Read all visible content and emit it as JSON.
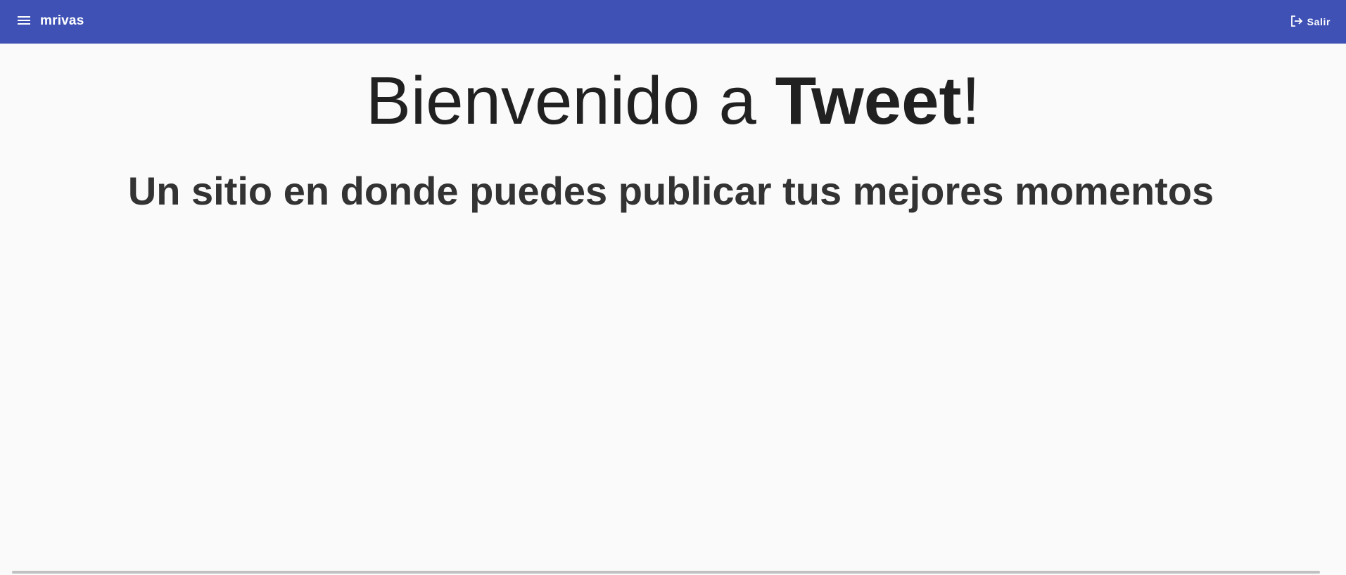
{
  "toolbar": {
    "menu_icon": "menu-icon",
    "brand": "mrivas",
    "logout_icon": "logout-icon",
    "logout_label": "Salir",
    "background": "#3f51b5"
  },
  "hero": {
    "title_prefix": "Bienvenido a ",
    "title_strong": "Tweet",
    "title_suffix": "!",
    "subtitle": "Un sitio en donde puedes publicar tus mejores momentos"
  }
}
